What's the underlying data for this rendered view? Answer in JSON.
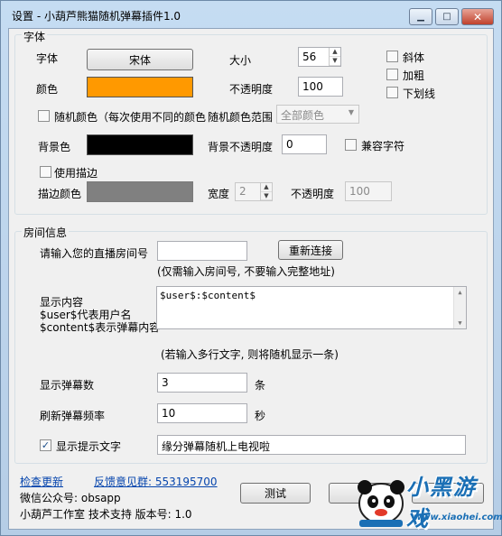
{
  "window": {
    "title": "设置 - 小葫芦熊猫随机弹幕插件1.0",
    "minimize_glyph": "▁",
    "maximize_glyph": "□",
    "close_glyph": "✕"
  },
  "font_group": {
    "legend": "字体",
    "font_label": "字体",
    "font_button": "宋体",
    "size_label": "大小",
    "size_value": "56",
    "italic_label": "斜体",
    "bold_label": "加粗",
    "underline_label": "下划线",
    "color_label": "颜色",
    "color_value": "#ff9900",
    "opacity_label": "不透明度",
    "opacity_value": "100",
    "random_color_label": "随机颜色（每次使用不同的颜色",
    "random_range_label": "随机颜色范围",
    "random_range_value": "全部颜色",
    "bg_label": "背景色",
    "bg_color": "#000000",
    "bg_opacity_label": "背景不透明度",
    "bg_opacity_value": "0",
    "compat_label": "兼容字符",
    "use_outline_label": "使用描边",
    "outline_color_label": "描边颜色",
    "outline_color": "#808080",
    "width_label": "宽度",
    "width_value": "2",
    "outline_opacity_label": "不透明度",
    "outline_opacity_value": "100"
  },
  "room_group": {
    "legend": "房间信息",
    "room_prompt": "请输入您的直播房间号",
    "room_value": "",
    "reconnect_button": "重新连接",
    "room_hint": "(仅需输入房间号, 不要输入完整地址)",
    "display_label_1": "显示内容",
    "display_label_2": "$user$代表用户名",
    "display_label_3": "$content$表示弹幕内容",
    "display_value": "$user$:$content$",
    "multiline_hint": "(若输入多行文字, 则将随机显示一条)",
    "count_label": "显示弹幕数",
    "count_value": "3",
    "count_unit": "条",
    "refresh_label": "刷新弹幕频率",
    "refresh_value": "10",
    "refresh_unit": "秒",
    "show_tip_label": "显示提示文字",
    "show_tip_value": "缘分弹幕随机上电视啦"
  },
  "footer": {
    "check_update": "检查更新",
    "feedback": "反馈意见群: 553195700",
    "wechat": "微信公众号: obsapp",
    "support": "小葫芦工作室 技术支持 版本号: 1.0",
    "test_button": "测试"
  },
  "watermark": {
    "brand": "小黑游戏",
    "url": "www.xiaohei.com"
  }
}
